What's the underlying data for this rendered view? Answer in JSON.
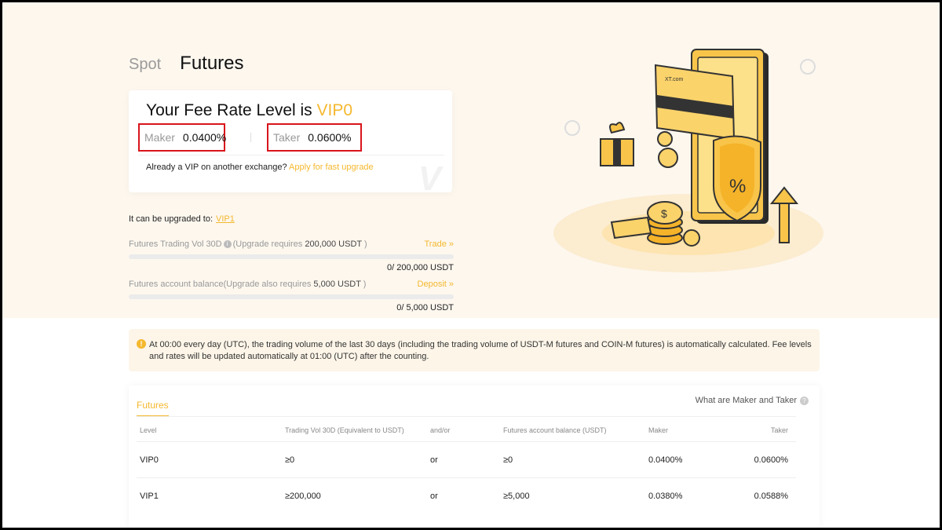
{
  "tabs": {
    "spot": "Spot",
    "futures": "Futures"
  },
  "fee_card": {
    "title_prefix": "Your Fee Rate Level is ",
    "level": "VIP0",
    "maker_label": "Maker",
    "maker_value": "0.0400%",
    "taker_label": "Taker",
    "taker_value": "0.0600%",
    "note": "Already a VIP on another exchange?",
    "note_link": "Apply for fast upgrade"
  },
  "upgrade": {
    "title": "It can be upgraded to:",
    "target_level": "VIP1",
    "trading_vol": {
      "label": "Futures Trading Vol 30D",
      "requirement_prefix": "(Upgrade requires ",
      "requirement_amount": "200,000 USDT",
      "requirement_suffix": " )",
      "action": "Trade »",
      "progress": 0,
      "amount": "0/ 200,000 USDT"
    },
    "balance": {
      "label": "Futures account balance(Upgrade also requires ",
      "requirement_amount": "5,000 USDT",
      "requirement_suffix": " )",
      "action": "Deposit »",
      "progress": 0,
      "amount": "0/ 5,000 USDT"
    }
  },
  "notice": {
    "text": "At 00:00 every day (UTC), the trading volume of the last 30 days (including the trading volume of USDT-M futures and COIN-M futures) is automatically calculated. Fee levels and rates will be updated automatically at 01:00 (UTC) after the counting."
  },
  "table": {
    "tab": "Futures",
    "help": "What are Maker and Taker",
    "headers": [
      "Level",
      "Trading Vol 30D (Equivalent to USDT)",
      "and/or",
      "Futures account balance (USDT)",
      "Maker",
      "Taker"
    ],
    "rows": [
      [
        "VIP0",
        "≥0",
        "or",
        "≥0",
        "0.0400%",
        "0.0600%"
      ],
      [
        "VIP1",
        "≥200,000",
        "or",
        "≥5,000",
        "0.0380%",
        "0.0588%"
      ]
    ]
  },
  "illustration": {
    "card_brand": "XT.com",
    "shield_symbol": "%",
    "coin_symbol": "$"
  },
  "colors": {
    "accent": "#f5b82e",
    "highlight_box": "#d9141b",
    "hero_bg": "#fdf7ee"
  },
  "icons": [
    "info-icon",
    "warning-icon",
    "help-icon",
    "double-chevron-right-icon"
  ]
}
